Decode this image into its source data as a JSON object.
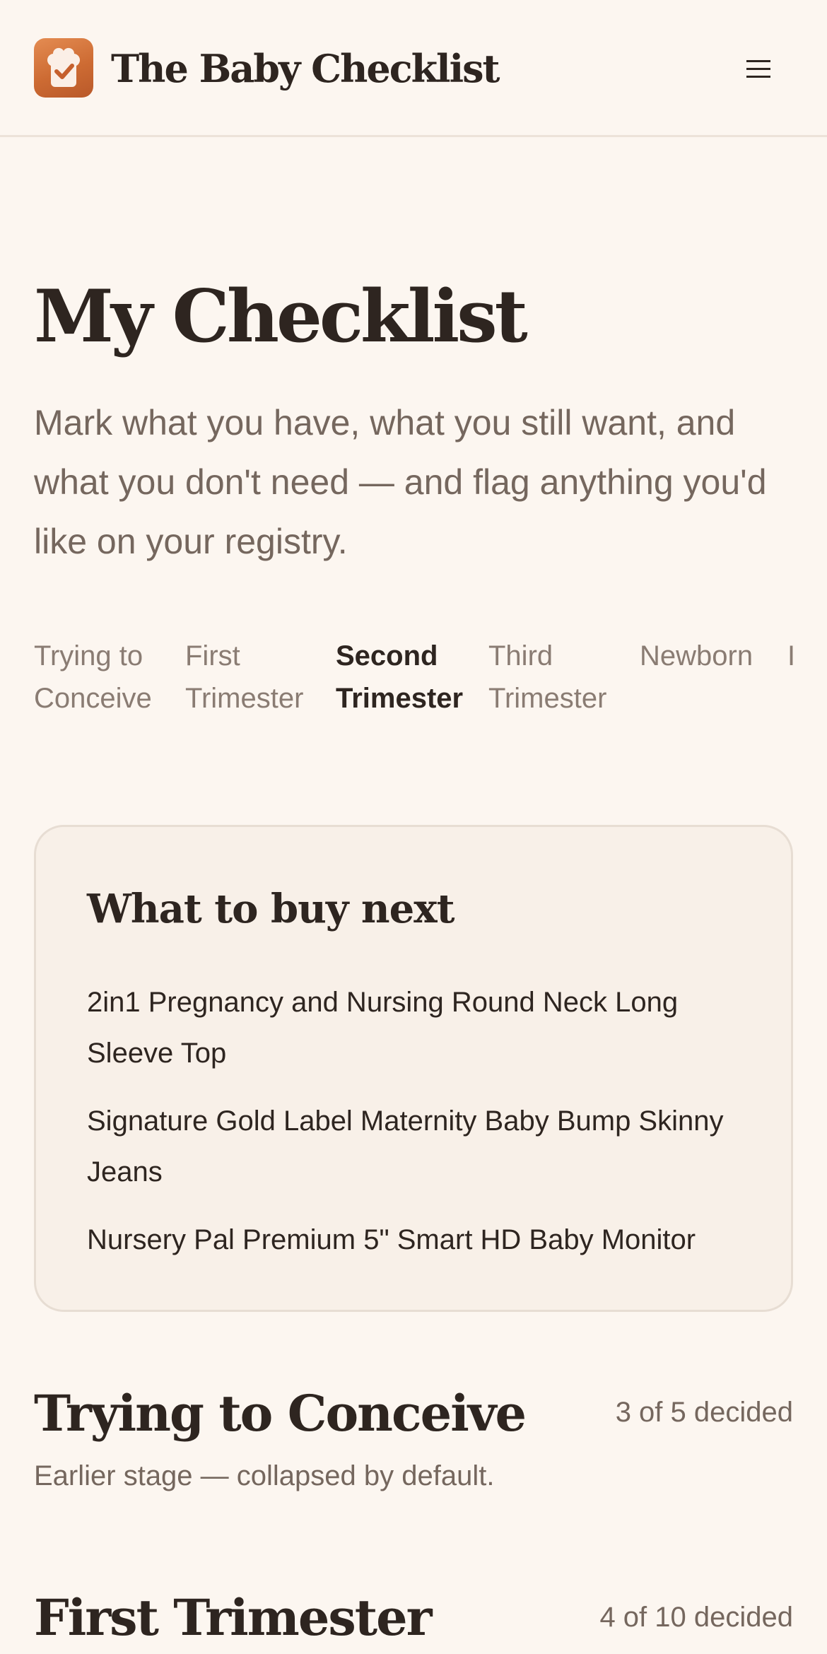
{
  "header": {
    "app_title": "The Baby Checklist",
    "logo_icon": "checklist-logo-icon",
    "menu_icon": "hamburger-menu-icon",
    "menu_glyph": "☰"
  },
  "page": {
    "title": "My Checklist",
    "subtitle": "Mark what you have, what you still want, and what you don't need — and flag anything you'd like on your registry."
  },
  "tabs": [
    {
      "line1": "Trying to",
      "line2": "Conceive",
      "active": false
    },
    {
      "line1": "First",
      "line2": "Trimester",
      "active": false
    },
    {
      "line1": "Second",
      "line2": "Trimester",
      "active": true
    },
    {
      "line1": "Third",
      "line2": "Trimester",
      "active": false
    },
    {
      "line1": "Newborn",
      "line2": "",
      "active": false
    },
    {
      "line1": "I",
      "line2": "",
      "active": false
    }
  ],
  "buy_next": {
    "title": "What to buy next",
    "items": [
      "2in1 Pregnancy and Nursing Round Neck Long Sleeve Top",
      "Signature Gold Label Maternity Baby Bump Skinny Jeans",
      "Nursery Pal Premium 5\" Smart HD Baby Monitor"
    ]
  },
  "sections": [
    {
      "title": "Trying to Conceive",
      "count": "3 of 5 decided",
      "note": "Earlier stage — collapsed by default."
    },
    {
      "title": "First Trimester",
      "count": "4 of 10 decided"
    }
  ],
  "colors": {
    "background": "#fcf6f0",
    "accent": "#cd6b33",
    "text": "#2e2520",
    "muted": "#75675e"
  }
}
